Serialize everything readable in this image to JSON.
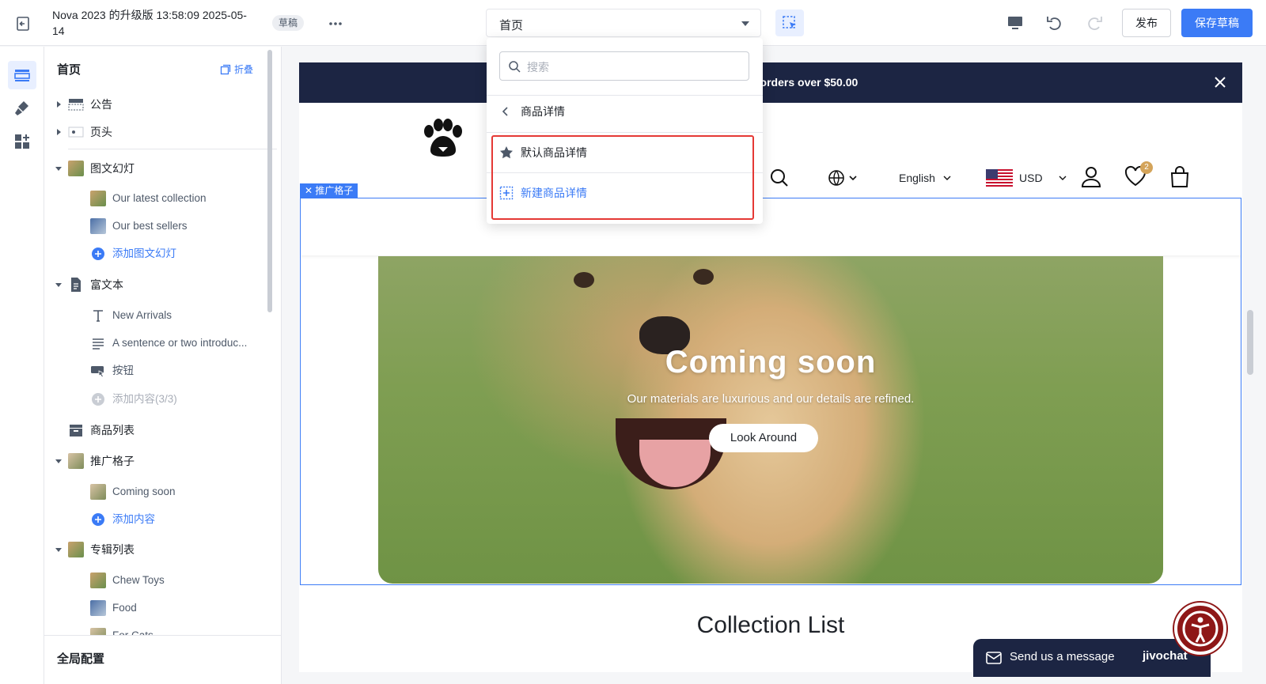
{
  "topbar": {
    "title": "Nova 2023 的升级版 13:58:09 2025-05-14",
    "status_badge": "草稿",
    "page_select": "首页",
    "publish_label": "发布",
    "save_draft_label": "保存草稿"
  },
  "page_dropdown": {
    "search_placeholder": "搜索",
    "back_label": "商品详情",
    "items": [
      {
        "label": "默认商品详情",
        "icon": "star-icon"
      },
      {
        "label": "新建商品详情",
        "icon": "add-page-icon"
      }
    ]
  },
  "sidebar": {
    "title": "首页",
    "collapse_label": "折叠",
    "sections": [
      {
        "label": "公告",
        "children": []
      },
      {
        "label": "页头",
        "children": []
      },
      {
        "label": "图文幻灯",
        "children": [
          "Our latest collection",
          "Our best sellers"
        ],
        "add_label": "添加图文幻灯"
      },
      {
        "label": "富文本",
        "children": [
          "New Arrivals",
          "A sentence or two introduc...",
          "按钮"
        ],
        "add_label": "添加内容(3/3)"
      },
      {
        "label": "商品列表",
        "children": []
      },
      {
        "label": "推广格子",
        "children": [
          "Coming soon"
        ],
        "add_label": "添加内容"
      },
      {
        "label": "专辑列表",
        "children": [
          "Chew Toys",
          "Food",
          "For Cats"
        ]
      }
    ],
    "global_config_label": "全局配置"
  },
  "preview": {
    "announcement": "for orders over $50.00",
    "language": "English",
    "currency": "USD",
    "wishlist_count": "2",
    "selected_section_tag": "推广格子",
    "hero": {
      "title": "Coming soon",
      "subtitle": "Our materials are luxurious and our details are refined.",
      "button": "Look Around"
    },
    "collection_title": "Collection List"
  },
  "chat_widget": {
    "message": "Send us a message",
    "brand": "jivochat"
  },
  "colors": {
    "accent": "#3b7bf6",
    "announcement_bg": "#1c2543",
    "highlight": "#e53935"
  }
}
